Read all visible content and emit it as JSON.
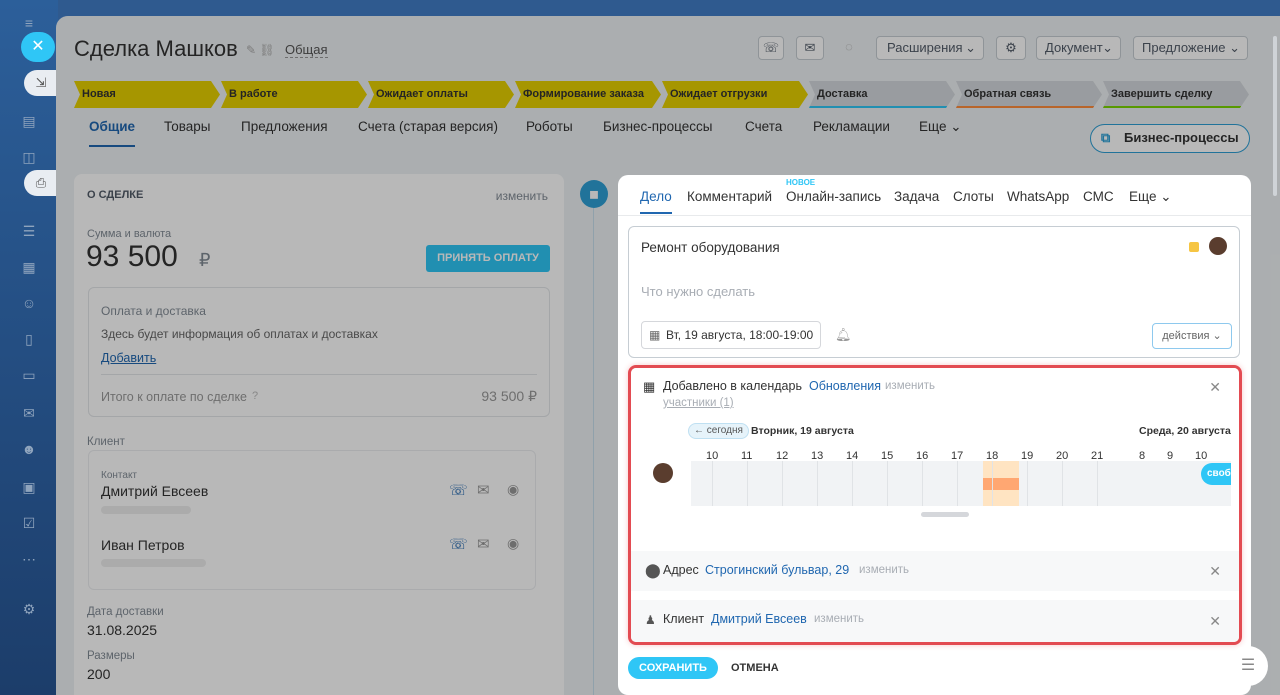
{
  "leftbar": {
    "close_icon": "close-icon"
  },
  "header": {
    "title": "Сделка Машков",
    "category": "Общая",
    "buttons": {
      "extensions": "Расширения",
      "document": "Документ",
      "offer": "Предложение"
    }
  },
  "stages": [
    {
      "label": "Новая",
      "state": "done",
      "color": "#e7d000"
    },
    {
      "label": "В работе",
      "state": "done",
      "color": "#e7d000"
    },
    {
      "label": "Ожидает оплаты",
      "state": "done",
      "color": "#e7d000"
    },
    {
      "label": "Формирование заказа",
      "state": "done",
      "color": "#e7d000"
    },
    {
      "label": "Ожидает отгрузки",
      "state": "done",
      "color": "#e7d000"
    },
    {
      "label": "Доставка",
      "state": "future",
      "color": "#2fc6f6"
    },
    {
      "label": "Обратная связь",
      "state": "future",
      "color": "#ff8d3c"
    },
    {
      "label": "Завершить сделку",
      "state": "future",
      "color": "#7bd500"
    }
  ],
  "tabs": [
    "Общие",
    "Товары",
    "Предложения",
    "Счета (старая версия)",
    "Роботы",
    "Бизнес-процессы",
    "Счета",
    "Рекламации",
    "Еще"
  ],
  "bp_button": "Бизнес-процессы",
  "deal": {
    "section": "О СДЕЛКЕ",
    "edit": "изменить",
    "sum_label": "Сумма и валюта",
    "sum": "93 500",
    "currency": "₽",
    "pay_button": "ПРИНЯТЬ ОПЛАТУ",
    "payment_title": "Оплата и доставка",
    "payment_info": "Здесь будет информация об оплатах и доставках",
    "add": "Добавить",
    "total_label": "Итого к оплате по сделке",
    "total": "93 500 ₽",
    "client_label": "Клиент",
    "contact_label": "Контакт",
    "contact1": "Дмитрий Евсеев",
    "contact2": "Иван Петров",
    "delivery_label": "Дата доставки",
    "delivery": "31.08.2025",
    "size_label": "Размеры",
    "size": "200"
  },
  "activity": {
    "tabs": [
      "Дело",
      "Комментарий",
      "Онлайн-запись",
      "Задача",
      "Слоты",
      "WhatsApp",
      "СМС",
      "Еще"
    ],
    "new_tag": "НОВОЕ",
    "task_title": "Ремонт оборудования",
    "placeholder": "Что нужно сделать",
    "datetime": "Вт, 19 августа, 18:00-19:00",
    "actions": "действия",
    "calendar_text": "Добавлено в календарь",
    "updates": "Обновления",
    "change": "изменить",
    "participants": "участники (1)",
    "today": "← сегодня",
    "day1": "Вторник, 19 августа",
    "day2": "Среда, 20 августа",
    "hours1": [
      "10",
      "11",
      "12",
      "13",
      "14",
      "15",
      "16",
      "17",
      "18",
      "19",
      "20",
      "21"
    ],
    "hours2": [
      "8",
      "9",
      "10"
    ],
    "busy": "своб",
    "address_label": "Адрес",
    "address": "Строгинский бульвар, 29",
    "client_label": "Клиент",
    "client": "Дмитрий Евсеев",
    "save": "СОХРАНИТЬ",
    "cancel": "ОТМЕНА"
  },
  "colors": {
    "accent": "#2fc6f6",
    "link": "#2067b0",
    "highlight": "#e34b52",
    "stage_done": "#e7d000"
  }
}
